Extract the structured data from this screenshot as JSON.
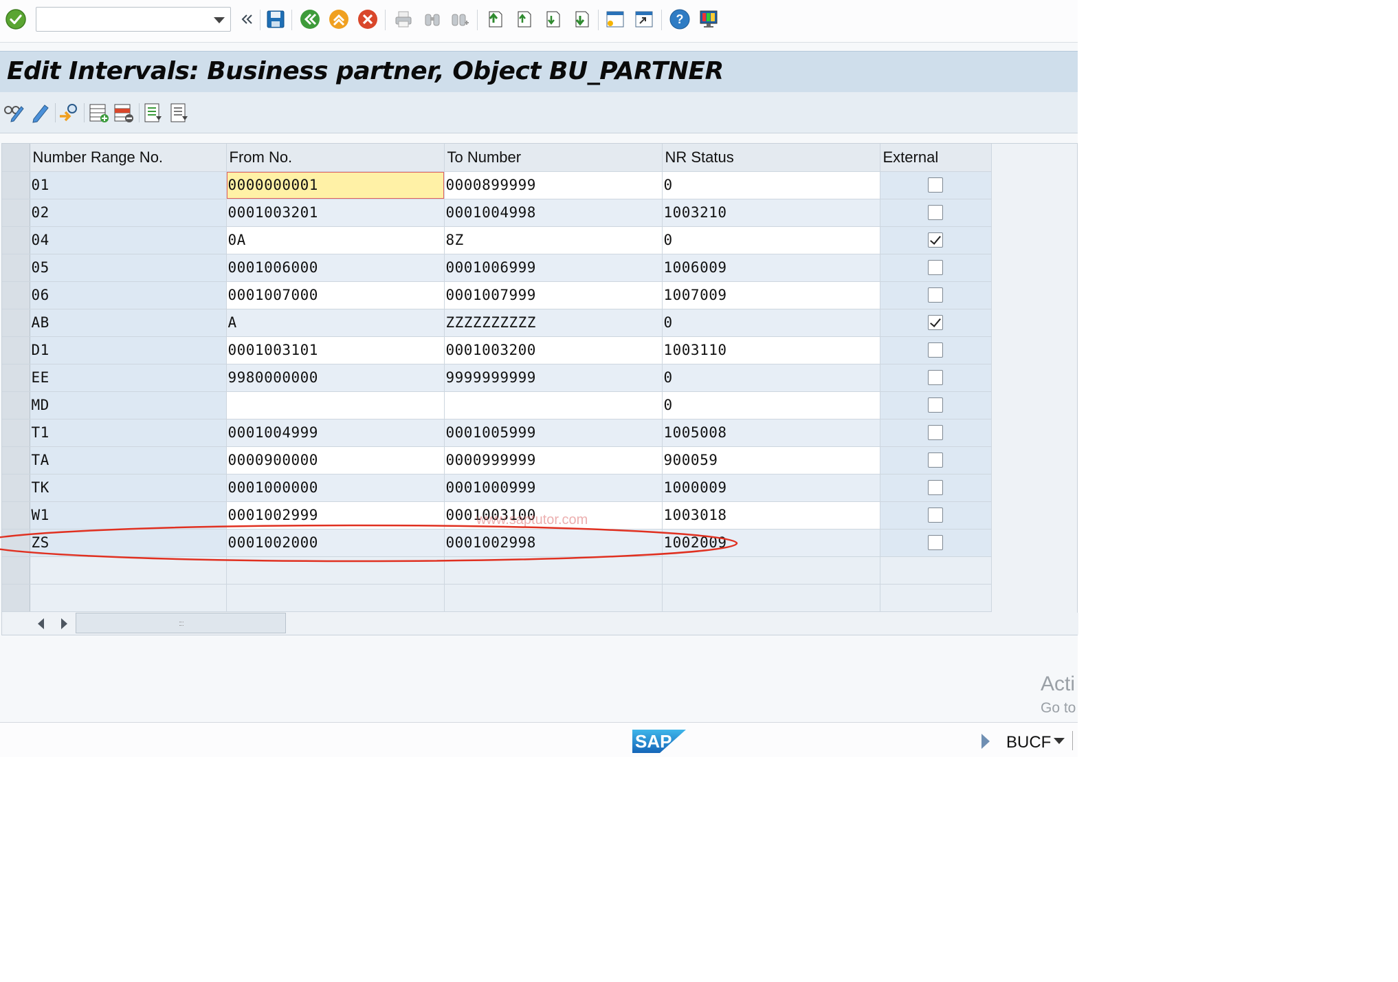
{
  "toolbar": {
    "command_field_value": "",
    "icons": [
      "enter-icon",
      "back-icon",
      "save-icon",
      "back-green-icon",
      "exit-icon",
      "cancel-icon",
      "print-icon",
      "find-icon",
      "find-next-icon",
      "first-page-icon",
      "previous-page-icon",
      "next-page-icon",
      "last-page-icon",
      "create-session-icon",
      "create-shortcut-icon",
      "help-icon",
      "customize-layout-icon"
    ]
  },
  "title": "Edit Intervals: Business partner, Object BU_PARTNER",
  "app_toolbar": {
    "icons": [
      "display-change-icon",
      "change-pencil-icon",
      "where-used-icon",
      "insert-interval-icon",
      "delete-interval-icon",
      "select-all-icon",
      "deselect-all-icon"
    ]
  },
  "table": {
    "headers": {
      "number_range_no": "Number Range No.",
      "from_no": "From No.",
      "to_number": "To Number",
      "nr_status": "NR Status",
      "external": "External"
    },
    "rows": [
      {
        "no": "01",
        "from": "0000000001",
        "to": "0000899999",
        "status": "0",
        "external": false
      },
      {
        "no": "02",
        "from": "0001003201",
        "to": "0001004998",
        "status": "1003210",
        "external": false
      },
      {
        "no": "04",
        "from": "0A",
        "to": "8Z",
        "status": "0",
        "external": true
      },
      {
        "no": "05",
        "from": "0001006000",
        "to": "0001006999",
        "status": "1006009",
        "external": false
      },
      {
        "no": "06",
        "from": "0001007000",
        "to": "0001007999",
        "status": "1007009",
        "external": false
      },
      {
        "no": "AB",
        "from": "A",
        "to": "ZZZZZZZZZZ",
        "status": "0",
        "external": true
      },
      {
        "no": "D1",
        "from": "0001003101",
        "to": "0001003200",
        "status": "1003110",
        "external": false
      },
      {
        "no": "EE",
        "from": "9980000000",
        "to": "9999999999",
        "status": "0",
        "external": false
      },
      {
        "no": "MD",
        "from": "",
        "to": "",
        "status": "0",
        "external": false
      },
      {
        "no": "T1",
        "from": "0001004999",
        "to": "0001005999",
        "status": "1005008",
        "external": false
      },
      {
        "no": "TA",
        "from": "0000900000",
        "to": "0000999999",
        "status": "900059",
        "external": false
      },
      {
        "no": "TK",
        "from": "0001000000",
        "to": "0001000999",
        "status": "1000009",
        "external": false
      },
      {
        "no": "W1",
        "from": "0001002999",
        "to": "0001003100",
        "status": "1003018",
        "external": false
      },
      {
        "no": "ZS",
        "from": "0001002000",
        "to": "0001002998",
        "status": "1002009",
        "external": false
      }
    ],
    "highlighted_row": "ZS",
    "highlight_color": "#e03020"
  },
  "watermark": "www.saptutor.com",
  "status_bar": {
    "logo": "SAP",
    "system": "BUCF"
  },
  "os_overlay": {
    "line1": "Acti",
    "line2": "Go to"
  },
  "colors": {
    "title_bar": "#cfdeeb",
    "key_column": "#dde8f3",
    "focused_cell": "#fff1a6"
  }
}
